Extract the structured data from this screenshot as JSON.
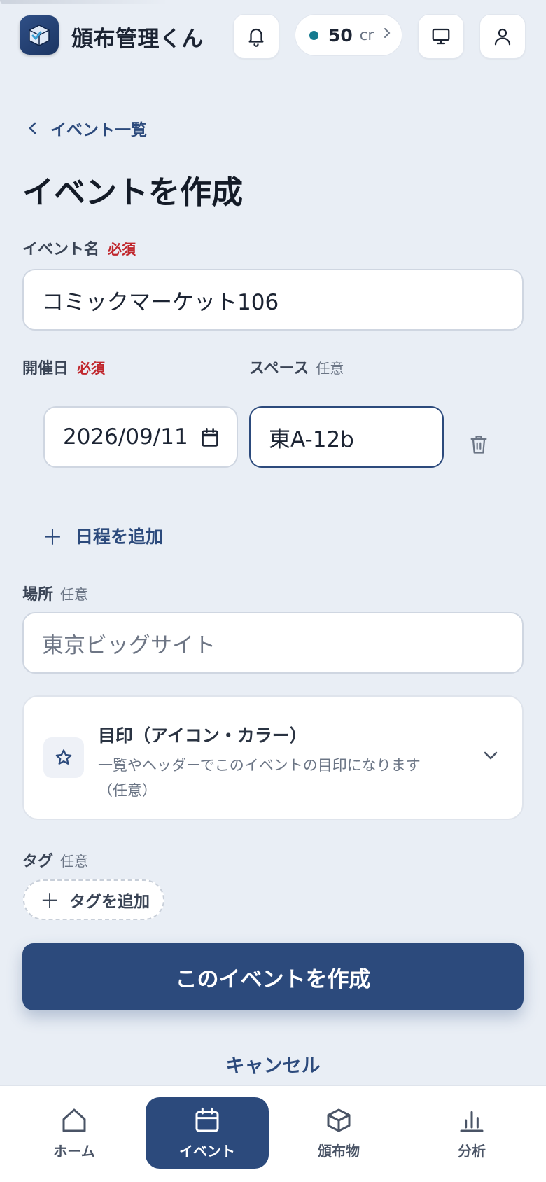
{
  "app": {
    "title": "頒布管理くん"
  },
  "header": {
    "credits_value": "50",
    "credits_unit": "cr"
  },
  "nav_back": {
    "label": "イベント一覧"
  },
  "page": {
    "title": "イベントを作成"
  },
  "form": {
    "event_name": {
      "label": "イベント名",
      "badge": "必須",
      "value": "コミックマーケット106"
    },
    "date": {
      "label": "開催日",
      "badge": "必須",
      "value": "2026/09/11"
    },
    "space": {
      "label": "スペース",
      "badge": "任意",
      "value": "東A-12b"
    },
    "add_date_label": "日程を追加",
    "place": {
      "label": "場所",
      "badge": "任意",
      "placeholder": "東京ビッグサイト"
    },
    "mark": {
      "title": "目印（アイコン・カラー）",
      "description": "一覧やヘッダーでこのイベントの目印になります（任意）"
    },
    "tags": {
      "label": "タグ",
      "badge": "任意",
      "add_label": "タグを追加"
    },
    "submit_label": "このイベントを作成",
    "cancel_label": "キャンセル"
  },
  "bottom_nav": {
    "items": [
      {
        "label": "ホーム",
        "icon": "home-icon"
      },
      {
        "label": "イベント",
        "icon": "calendar-icon",
        "active": true
      },
      {
        "label": "頒布物",
        "icon": "box-icon"
      },
      {
        "label": "分析",
        "icon": "bar-chart-icon"
      }
    ]
  },
  "colors": {
    "accent": "#2c4a7c",
    "required": "#c0272d",
    "background": "#e9eef5"
  }
}
